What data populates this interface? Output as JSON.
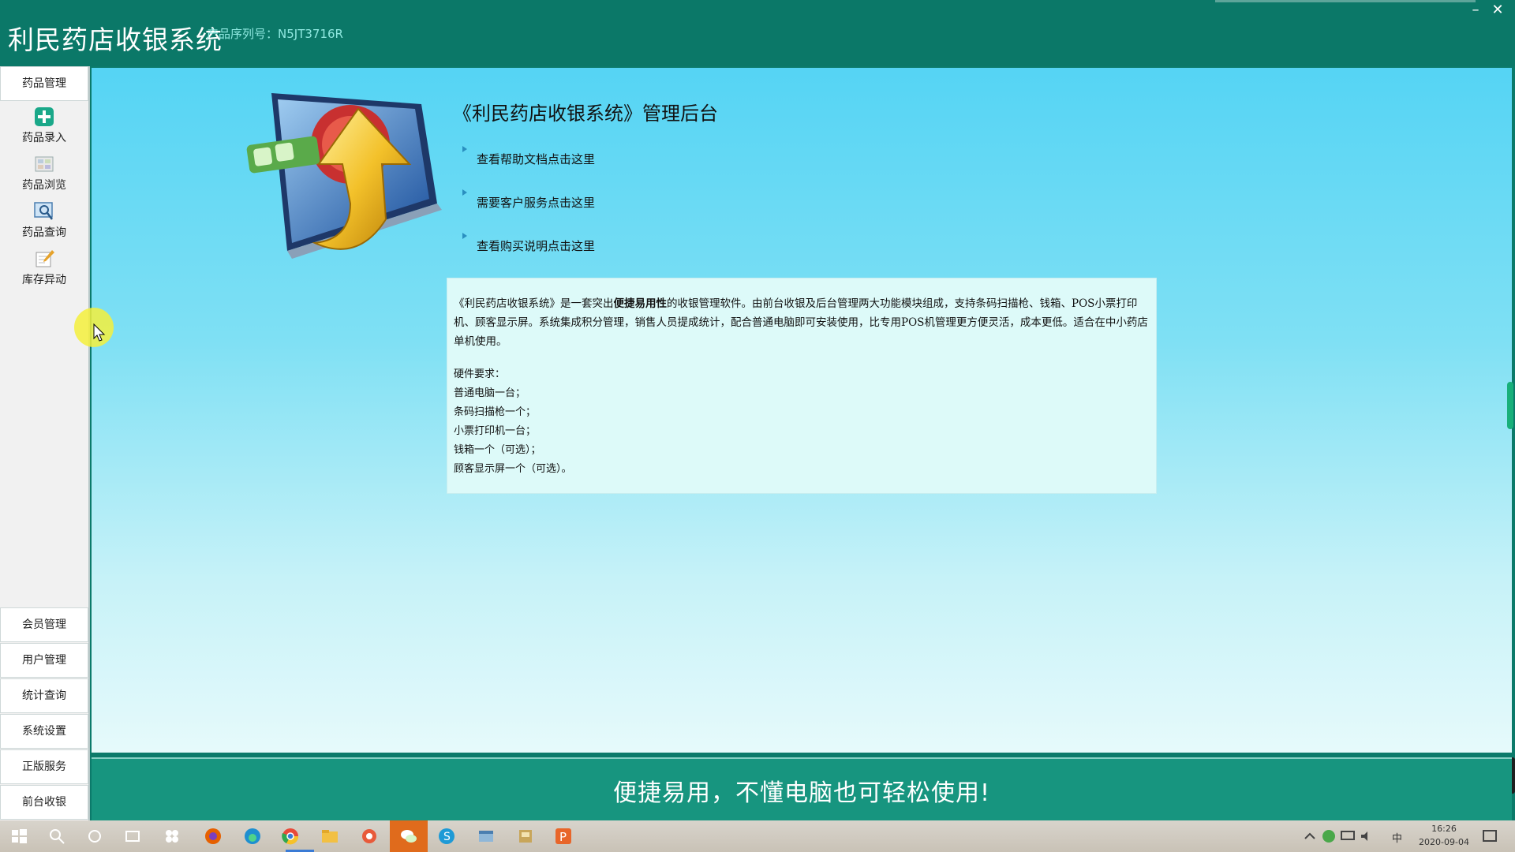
{
  "window": {
    "title": "利民药店收银系统",
    "serial_label": "产品序列号：",
    "serial_value": "N5JT3716R",
    "minimize": "–",
    "close": "✕"
  },
  "sidebar": {
    "top_section": "药品管理",
    "items": [
      {
        "label": "药品录入",
        "icon": "add-drug-icon"
      },
      {
        "label": "药品浏览",
        "icon": "browse-icon"
      },
      {
        "label": "药品查询",
        "icon": "search-icon"
      },
      {
        "label": "库存异动",
        "icon": "edit-icon"
      }
    ],
    "bottom_sections": [
      "会员管理",
      "用户管理",
      "统计查询",
      "系统设置",
      "正版服务",
      "前台收银"
    ]
  },
  "main": {
    "title": "《利民药店收银系统》管理后台",
    "links": [
      "查看帮助文档点击这里",
      "需要客户服务点击这里",
      "查看购买说明点击这里"
    ],
    "description": {
      "intro_before": "《利民药店收银系统》是一套突出",
      "intro_bold": "便捷易用性",
      "intro_after": "的收银管理软件。由前台收银及后台管理两大功能模块组成，支持条码扫描枪、钱箱、POS小票打印机、顾客显示屏。系统集成积分管理，销售人员提成统计，配合普通电脑即可安装使用，比专用POS机管理更方便灵活，成本更低。适合在中小药店单机使用。",
      "hardware_title": "硬件要求：",
      "hardware_items": [
        "普通电脑一台；",
        "条码扫描枪一个；",
        "小票打印机一台；",
        "钱箱一个（可选）；",
        "顾客显示屏一个（可选）。"
      ]
    }
  },
  "banner": {
    "text": "便捷易用，不懂电脑也可轻松使用!"
  },
  "taskbar": {
    "time": "16:26",
    "date": "2020-09-04",
    "ime": "中",
    "colors": {
      "accent_teal": "#0b7868",
      "active_app": "#e06b1c"
    }
  }
}
